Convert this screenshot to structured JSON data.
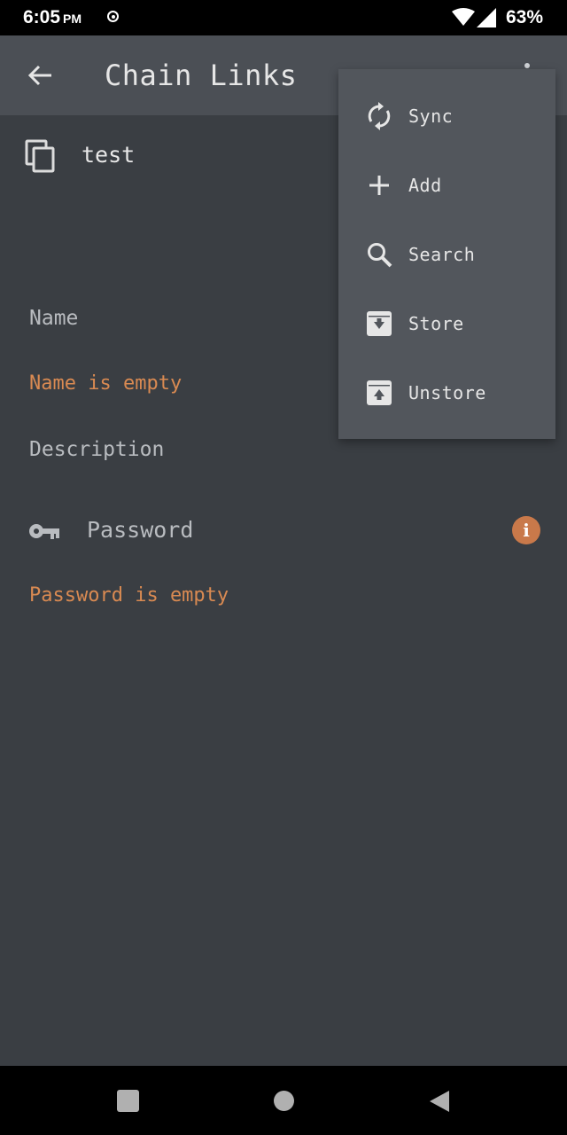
{
  "status_bar": {
    "time": "6:05",
    "ampm": "PM",
    "battery": "63%"
  },
  "app_bar": {
    "title": "Chain Links"
  },
  "content": {
    "item_name": "test",
    "name_label": "Name",
    "name_error": "Name is empty",
    "description_label": "Description",
    "password_label": "Password",
    "password_error": "Password is empty",
    "info_glyph": "i"
  },
  "menu": {
    "items": [
      {
        "label": "Sync",
        "icon": "sync-icon"
      },
      {
        "label": "Add",
        "icon": "add-icon"
      },
      {
        "label": "Search",
        "icon": "search-icon"
      },
      {
        "label": "Store",
        "icon": "archive-down-icon"
      },
      {
        "label": "Unstore",
        "icon": "archive-up-icon"
      }
    ]
  },
  "colors": {
    "background": "#3a3e43",
    "app_bar": "#4b4f55",
    "menu": "#52565c",
    "error": "#d98a52",
    "info_badge": "#c9794a"
  }
}
